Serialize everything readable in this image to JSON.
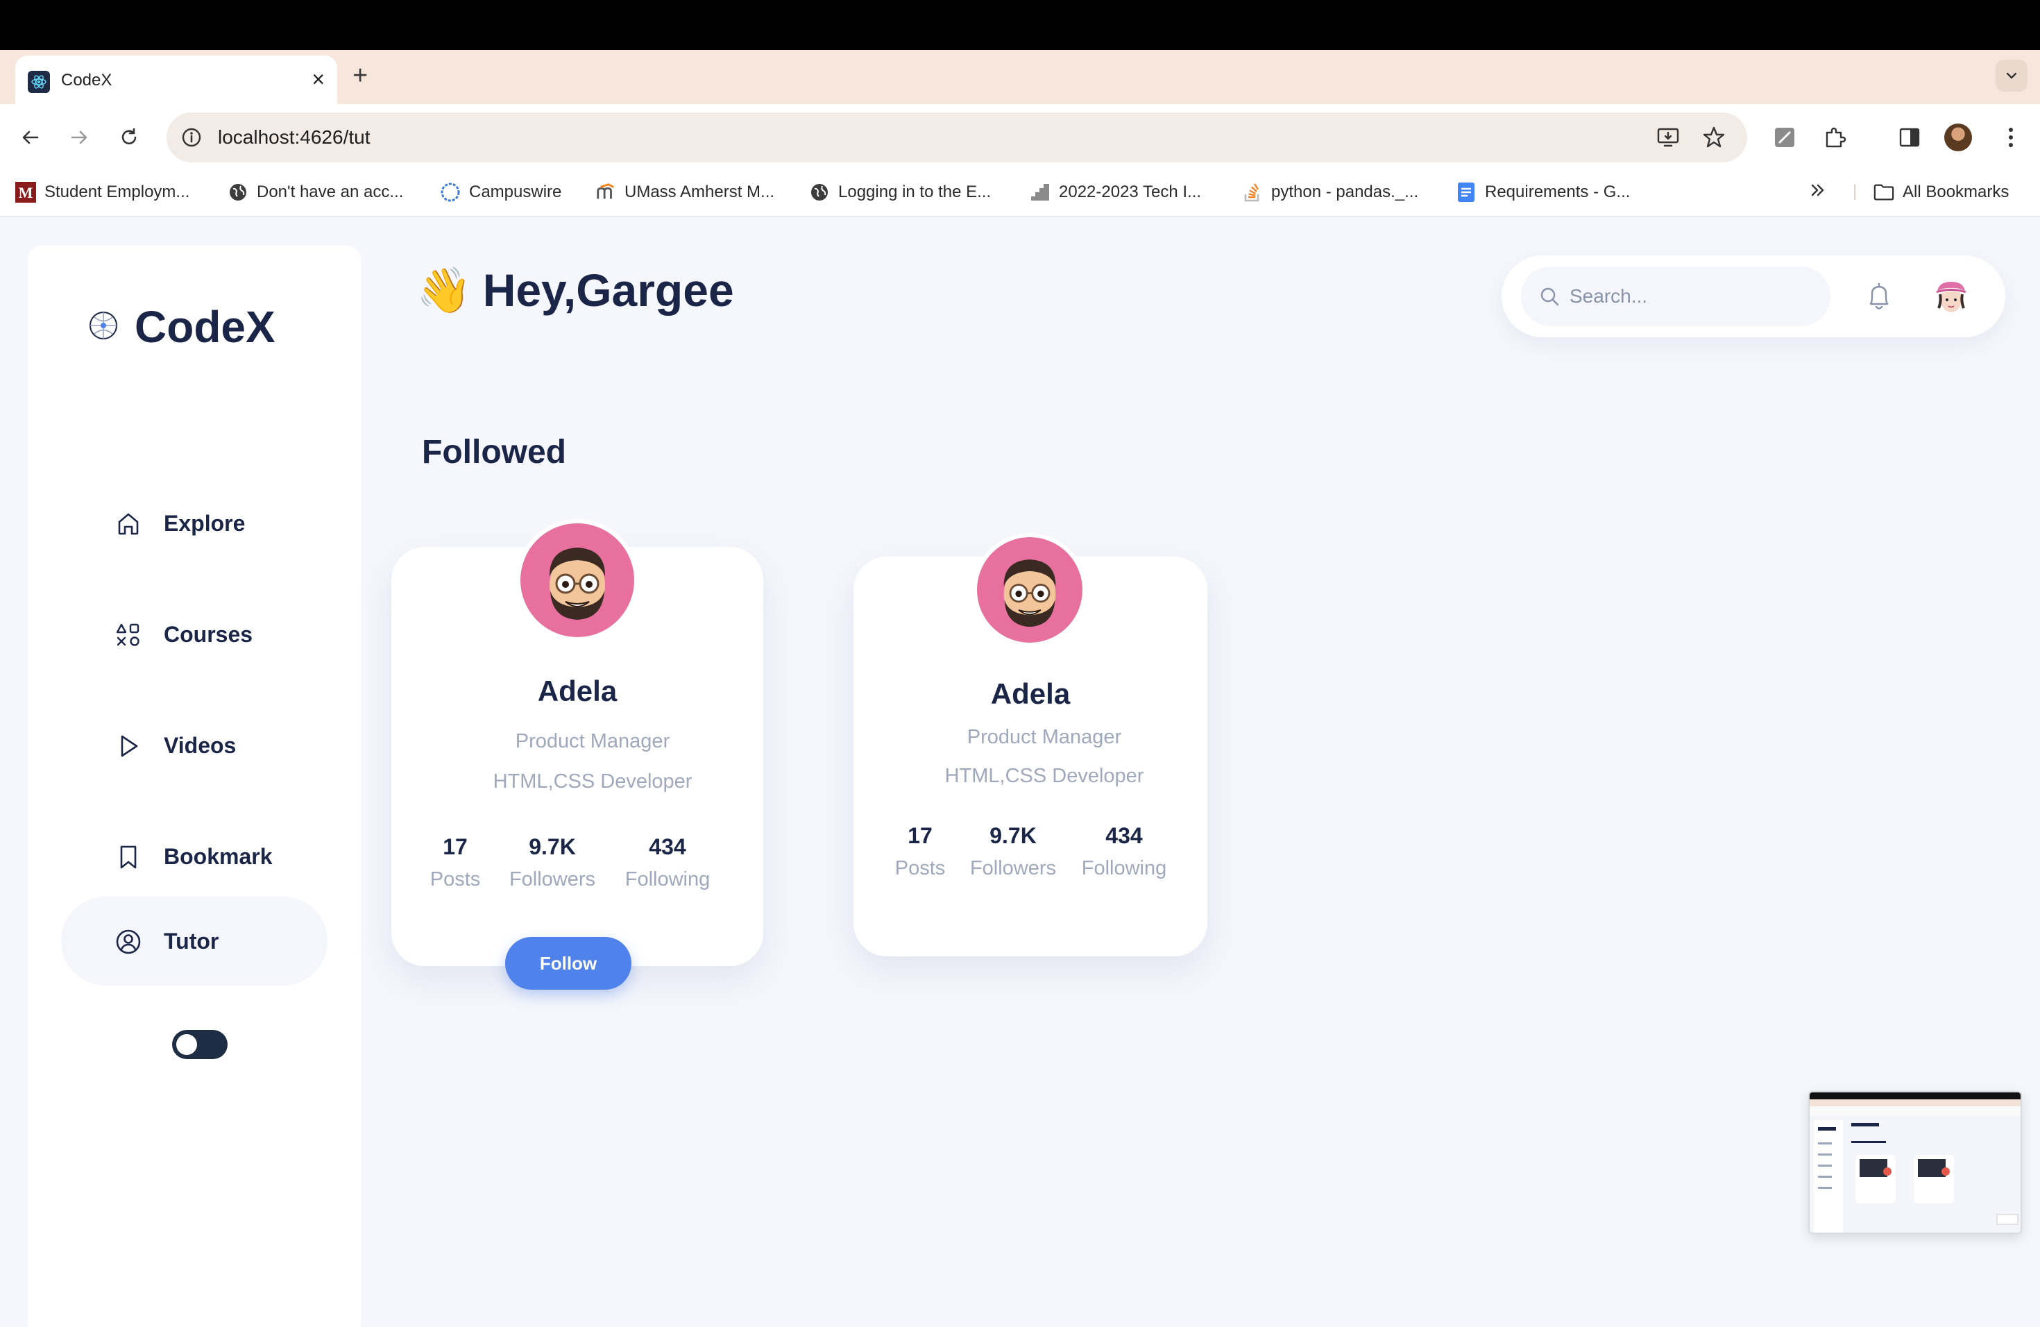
{
  "browser": {
    "tab_title": "CodeX",
    "url": "localhost:4626/tut",
    "bookmarks": [
      {
        "label": "Student Employm...",
        "icon": "umass-m-icon"
      },
      {
        "label": "Don't have an acc...",
        "icon": "globe-icon"
      },
      {
        "label": "Campuswire",
        "icon": "campuswire-icon"
      },
      {
        "label": "UMass Amherst M...",
        "icon": "moodle-icon"
      },
      {
        "label": "Logging in to the E...",
        "icon": "globe-icon"
      },
      {
        "label": "2022-2023 Tech I...",
        "icon": "chart-icon"
      },
      {
        "label": "python - pandas._...",
        "icon": "stackoverflow-icon"
      },
      {
        "label": "Requirements - G...",
        "icon": "google-docs-icon"
      }
    ],
    "all_bookmarks": "All Bookmarks"
  },
  "app": {
    "logo": "CodeX",
    "greeting_emoji": "👋",
    "greeting": "Hey,Gargee",
    "search_placeholder": "Search...",
    "nav": [
      {
        "label": "Explore",
        "icon": "home-icon"
      },
      {
        "label": "Courses",
        "icon": "shapes-icon"
      },
      {
        "label": "Videos",
        "icon": "play-icon"
      },
      {
        "label": "Bookmark",
        "icon": "bookmark-icon"
      },
      {
        "label": "Tutor",
        "icon": "user-circle-icon",
        "active": true
      }
    ],
    "section_title": "Followed",
    "cards": [
      {
        "name": "Adela",
        "role": "Product Manager",
        "skill": "HTML,CSS Developer",
        "stats": [
          {
            "value": "17",
            "label": "Posts"
          },
          {
            "value": "9.7K",
            "label": "Followers"
          },
          {
            "value": "434",
            "label": "Following"
          }
        ],
        "button": "Follow"
      },
      {
        "name": "Adela",
        "role": "Product Manager",
        "skill": "HTML,CSS Developer",
        "stats": [
          {
            "value": "17",
            "label": "Posts"
          },
          {
            "value": "9.7K",
            "label": "Followers"
          },
          {
            "value": "434",
            "label": "Following"
          }
        ]
      }
    ]
  },
  "colors": {
    "accent": "#4f82ea",
    "text_dark": "#1b2547",
    "avatar_bg": "#e8709f",
    "app_bg": "#f5f7fc"
  }
}
